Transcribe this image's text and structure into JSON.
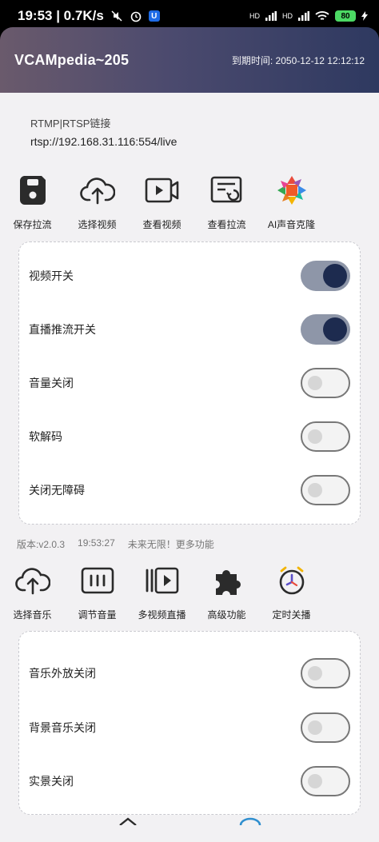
{
  "status_bar": {
    "time_speed": "19:53 | 0.7K/s",
    "signal_1": "HD",
    "signal_2": "HD",
    "battery": "80"
  },
  "header": {
    "title": "VCAMpedia~205",
    "expire": "到期时间: 2050-12-12 12:12:12"
  },
  "rtmp": {
    "label": "RTMP|RTSP链接",
    "url": "rtsp://192.168.31.116:554/live"
  },
  "top_actions": [
    {
      "label": "保存拉流",
      "icon": "save-icon"
    },
    {
      "label": "选择视频",
      "icon": "cloud-upload-icon"
    },
    {
      "label": "查看视频",
      "icon": "video-icon"
    },
    {
      "label": "查看拉流",
      "icon": "stream-icon"
    },
    {
      "label": "AI声音克隆",
      "icon": "ai-logo-icon"
    }
  ],
  "toggles_1": [
    {
      "label": "视频开关",
      "on": true
    },
    {
      "label": "直播推流开关",
      "on": true
    },
    {
      "label": "音量关闭",
      "on": false
    },
    {
      "label": "软解码",
      "on": false
    },
    {
      "label": "关闭无障碍",
      "on": false
    }
  ],
  "version_line": {
    "version": "版本:v2.0.3",
    "time": "19:53:27",
    "promo": "未来无限！更多功能"
  },
  "bottom_actions": [
    {
      "label": "选择音乐",
      "icon": "cloud-upload-icon"
    },
    {
      "label": "调节音量",
      "icon": "volume-bars-icon"
    },
    {
      "label": "多视频直播",
      "icon": "multi-video-icon"
    },
    {
      "label": "高级功能",
      "icon": "puzzle-icon"
    },
    {
      "label": "定时关播",
      "icon": "alarm-clock-icon"
    }
  ],
  "toggles_2": [
    {
      "label": "音乐外放关闭",
      "on": false
    },
    {
      "label": "背景音乐关闭",
      "on": false
    },
    {
      "label": "实景关闭",
      "on": false
    }
  ],
  "colors": {
    "header_start": "#6a5a6c",
    "header_end": "#2e3960",
    "toggle_on_track": "#8e96a8",
    "toggle_on_knob": "#1d2b4f",
    "background": "#f2f1f3"
  }
}
